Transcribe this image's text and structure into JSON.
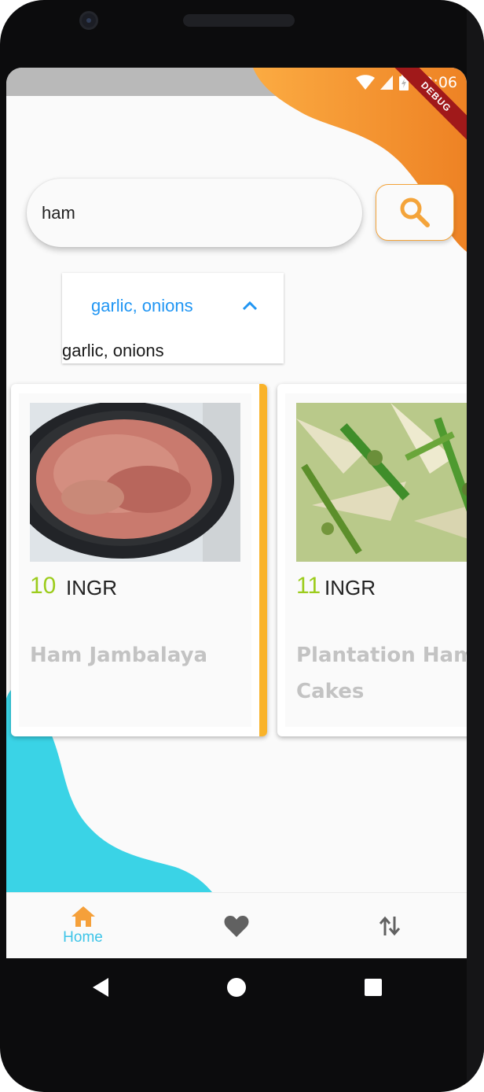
{
  "status_bar": {
    "time": "12:06"
  },
  "debug_banner": "DEBUG",
  "search": {
    "value": "ham",
    "placeholder": ""
  },
  "dropdown": {
    "selected": "garlic, onions",
    "options": [
      "garlic, onions"
    ]
  },
  "recipes": [
    {
      "count": "10",
      "unit": "INGR",
      "title": "Ham Jambalaya",
      "selected": true
    },
    {
      "count": "11",
      "unit": "INGR",
      "title": "Plantation Ham Cakes",
      "selected": false
    }
  ],
  "bottom_nav": {
    "items": [
      {
        "label": "Home",
        "icon": "home-icon",
        "active": true
      },
      {
        "label": "",
        "icon": "heart-icon"
      },
      {
        "label": "",
        "icon": "swap-icon"
      }
    ]
  },
  "colors": {
    "accent_orange": "#f4a43a",
    "cyan": "#3ad3e6",
    "count_green": "#9ccc1c",
    "link_blue": "#2196f3",
    "nav_active": "#3cc4e8"
  }
}
